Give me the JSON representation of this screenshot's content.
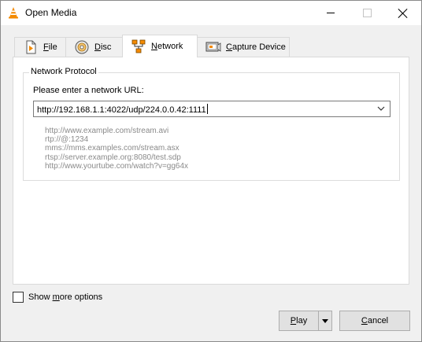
{
  "window": {
    "title": "Open Media",
    "icon": "vlc-cone-icon",
    "controls": [
      "minimize-icon",
      "maximize-icon",
      "close-icon"
    ]
  },
  "tabs": [
    {
      "label_pre": "",
      "label_ul": "F",
      "label_post": "ile",
      "icon": "file-icon",
      "active": false
    },
    {
      "label_pre": "",
      "label_ul": "D",
      "label_post": "isc",
      "icon": "disc-icon",
      "active": false
    },
    {
      "label_pre": "",
      "label_ul": "N",
      "label_post": "etwork",
      "icon": "network-icon",
      "active": true
    },
    {
      "label_pre": "",
      "label_ul": "C",
      "label_post": "apture Device",
      "icon": "capture-device-icon",
      "active": false
    }
  ],
  "network": {
    "group_title": "Network Protocol",
    "url_label": "Please enter a network URL:",
    "url_value": "http://192.168.1.1:4022/udp/224.0.0.42:1111",
    "examples": [
      "http://www.example.com/stream.avi",
      "rtp://@:1234",
      "mms://mms.examples.com/stream.asx",
      "rtsp://server.example.org:8080/test.sdp",
      "http://www.yourtube.com/watch?v=gg64x"
    ]
  },
  "footer": {
    "show_more_pre": "Show ",
    "show_more_ul": "m",
    "show_more_post": "ore options",
    "show_more_checked": false,
    "play_ul": "P",
    "play_post": "lay",
    "cancel_ul": "C",
    "cancel_post": "ancel"
  }
}
